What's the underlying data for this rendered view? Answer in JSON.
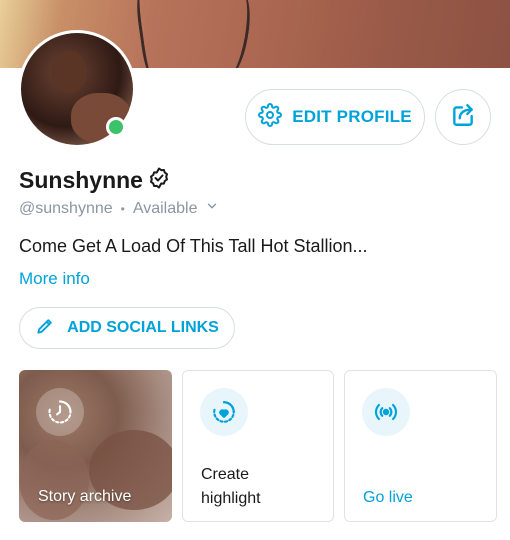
{
  "profile": {
    "name": "Sunshynne",
    "handle": "@sunshynne",
    "separator": "•",
    "availability": "Available",
    "bio": "Come Get A Load Of This Tall Hot Stallion...",
    "more_info": "More info",
    "online": true
  },
  "buttons": {
    "edit_profile": "EDIT PROFILE",
    "add_social_links": "ADD SOCIAL LINKS"
  },
  "cards": {
    "story_archive": "Story archive",
    "create_highlight": "Create highlight",
    "go_live": "Go live"
  },
  "colors": {
    "accent": "#00a3d9",
    "online": "#3cc36a",
    "muted": "#8a96a3"
  },
  "icons": [
    "gear-icon",
    "share-icon",
    "verified-icon",
    "chevron-down-icon",
    "pencil-icon",
    "clock-icon",
    "heart-icon",
    "broadcast-icon"
  ]
}
